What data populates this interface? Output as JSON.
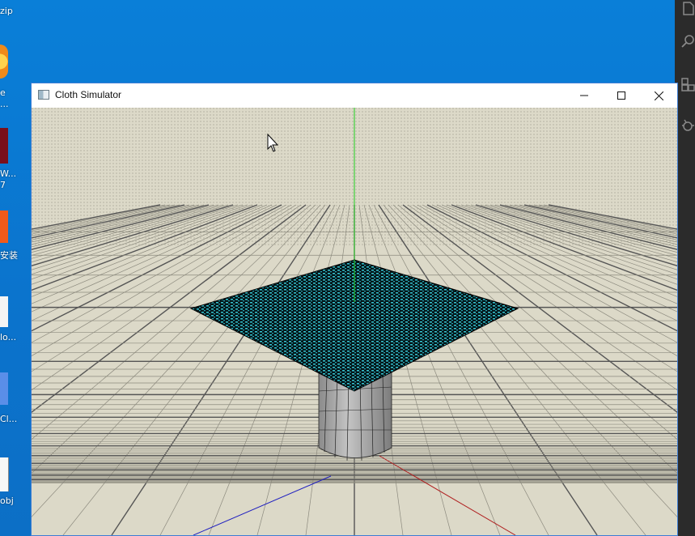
{
  "desktop": {
    "labels": [
      "zip",
      "e",
      "...",
      "W...",
      "7",
      "安装",
      "lo...",
      "Cl...",
      "obj"
    ],
    "icons": [
      "orange-app-icon",
      "red-app-icon",
      "orange-square-icon",
      "document-icon",
      "blue-app-icon",
      "file-icon"
    ]
  },
  "window": {
    "title": "Cloth Simulator",
    "icon": "cloth-app-icon",
    "controls": {
      "minimize": "minimize-icon",
      "maximize": "maximize-icon",
      "close": "close-icon"
    }
  },
  "scene": {
    "ground": "checkered-grid-floor",
    "colors": {
      "floor": "#dcd9c8",
      "cloth": "#38c6d3",
      "cylinder": "#a8a8a8",
      "axis_x": "#b02020",
      "axis_y": "#20d020",
      "axis_z": "#2020c0"
    }
  },
  "right_panel": {
    "icons": [
      "files-icon",
      "search-icon",
      "extensions-icon",
      "debug-icon"
    ]
  }
}
